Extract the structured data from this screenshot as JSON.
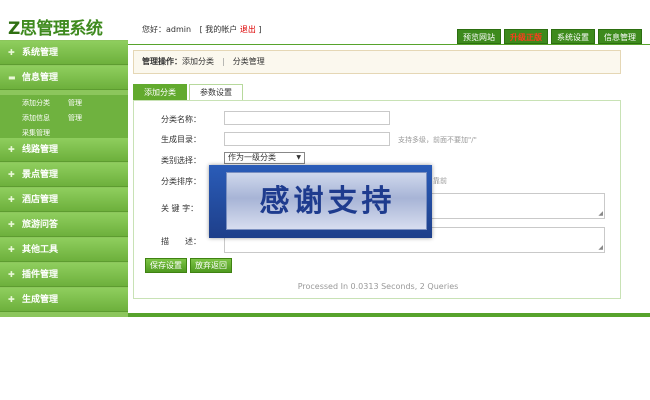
{
  "header": {
    "logo_prefix": "Z",
    "logo_text": "思管理系统",
    "greeting": "您好：admin",
    "bracket_open": "[",
    "my_account": "我的帐户",
    "logout": "退出",
    "bracket_close": "]",
    "nav": [
      "预览网站",
      "升级正版",
      "系统设置",
      "信息管理"
    ]
  },
  "sidebar": {
    "items": [
      {
        "icon": "plus-icon",
        "label": "系统管理"
      },
      {
        "icon": "minus-icon",
        "label": "信息管理"
      },
      {
        "icon": "plus-icon",
        "label": "线路管理"
      },
      {
        "icon": "plus-icon",
        "label": "景点管理"
      },
      {
        "icon": "plus-icon",
        "label": "酒店管理"
      },
      {
        "icon": "plus-icon",
        "label": "旅游问答"
      },
      {
        "icon": "plus-icon",
        "label": "其他工具"
      },
      {
        "icon": "plus-icon",
        "label": "插件管理"
      },
      {
        "icon": "plus-icon",
        "label": "生成管理"
      }
    ],
    "sub_items": [
      {
        "label": "添加分类",
        "manage": "管理"
      },
      {
        "label": "添加信息",
        "manage": "管理"
      },
      {
        "label": "采集管理",
        "manage": ""
      }
    ]
  },
  "operation_bar": {
    "title": "管理操作：",
    "add_category": "添加分类",
    "separator": "|",
    "category_manage": "分类管理"
  },
  "tabs": [
    "添加分类",
    "参数设置"
  ],
  "form": {
    "name_label": "分类名称：",
    "dir_label": "生成目录：",
    "dir_hint": "支持多级，前面不要加\"/\"",
    "type_label": "类别选择：",
    "type_value": "作为一级分类",
    "order_label": "分类排序：",
    "order_hint": "靠前",
    "keywords_label": "关 键 字：",
    "desc_label": "描　　述：",
    "save_button": "保存设置",
    "back_button": "放弃返回"
  },
  "footer": "Processed In 0.0313 Seconds, 2 Queries",
  "overlay_banner": "感谢支持",
  "colors": {
    "brand_green": "#57a32c",
    "sidebar_green": "#7bbd49",
    "upgrade_red": "#ff3b1e",
    "banner_blue": "#1e3b8e"
  }
}
